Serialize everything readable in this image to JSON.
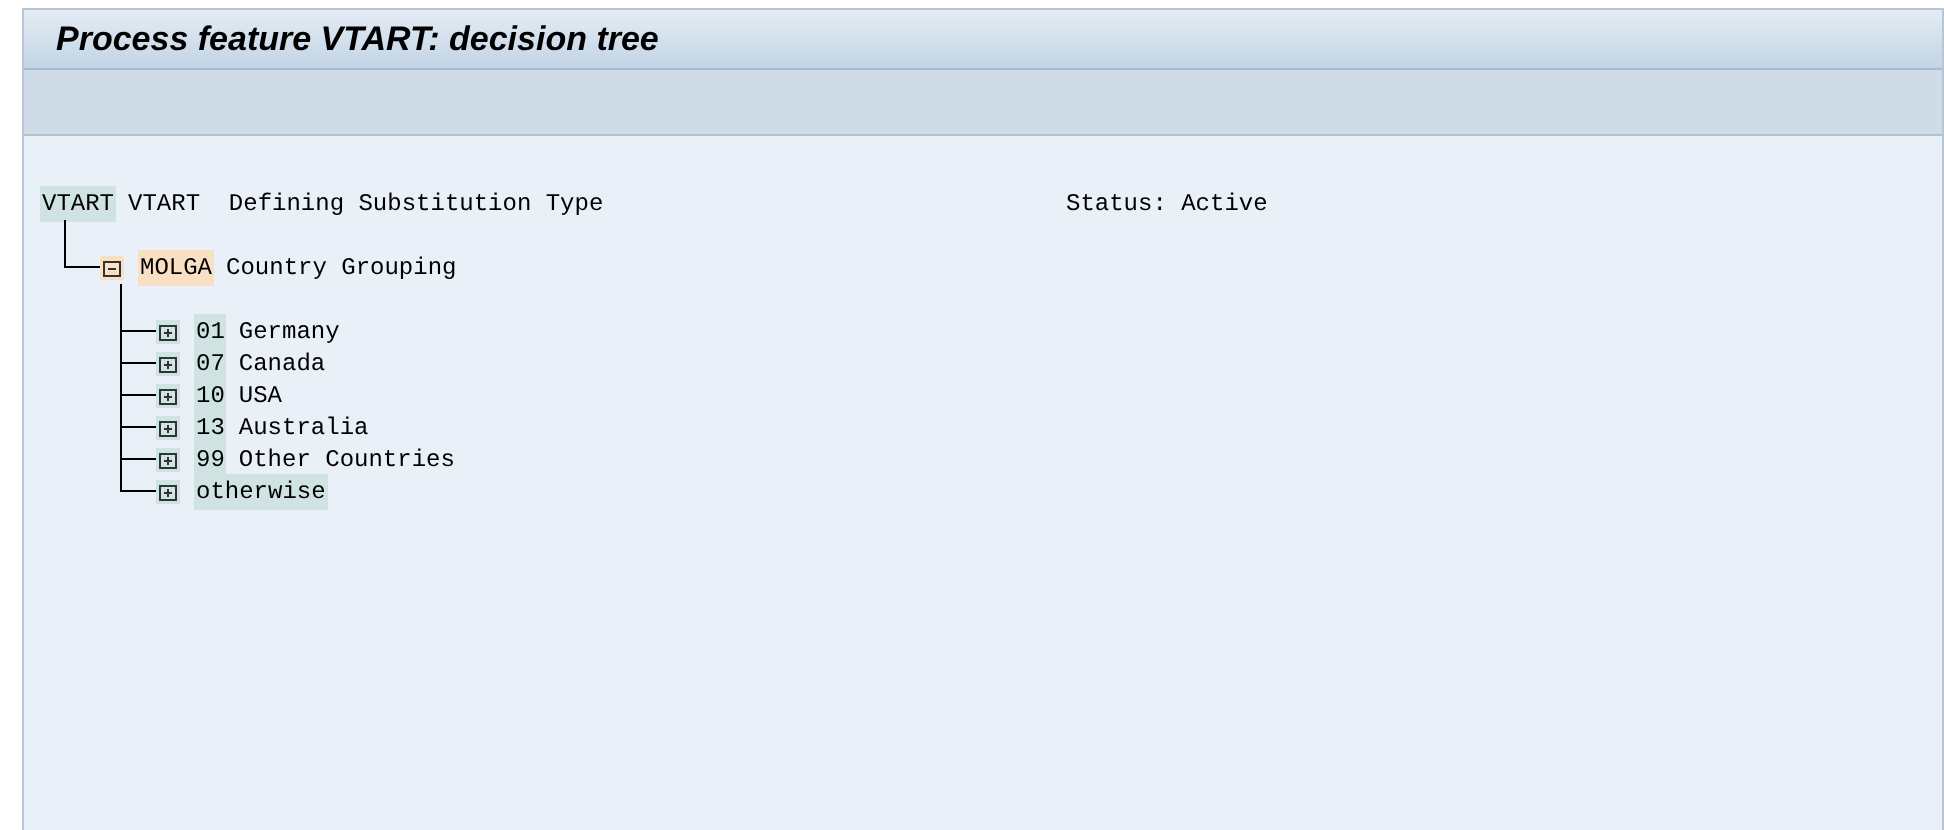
{
  "title": "Process feature VTART: decision tree",
  "root": {
    "key": "VTART",
    "text": "VTART  Defining Substitution Type",
    "status": "Status: Active",
    "children": [
      {
        "key": "MOLGA",
        "text": "Country Grouping",
        "expanded": true,
        "children": [
          {
            "key": "01",
            "text": "Germany",
            "expanded": false
          },
          {
            "key": "07",
            "text": "Canada",
            "expanded": false
          },
          {
            "key": "10",
            "text": "USA",
            "expanded": false
          },
          {
            "key": "13",
            "text": "Australia",
            "expanded": false
          },
          {
            "key": "99",
            "text": "Other Countries",
            "expanded": false
          },
          {
            "key": "otherwise",
            "expanded": false
          }
        ]
      }
    ]
  }
}
